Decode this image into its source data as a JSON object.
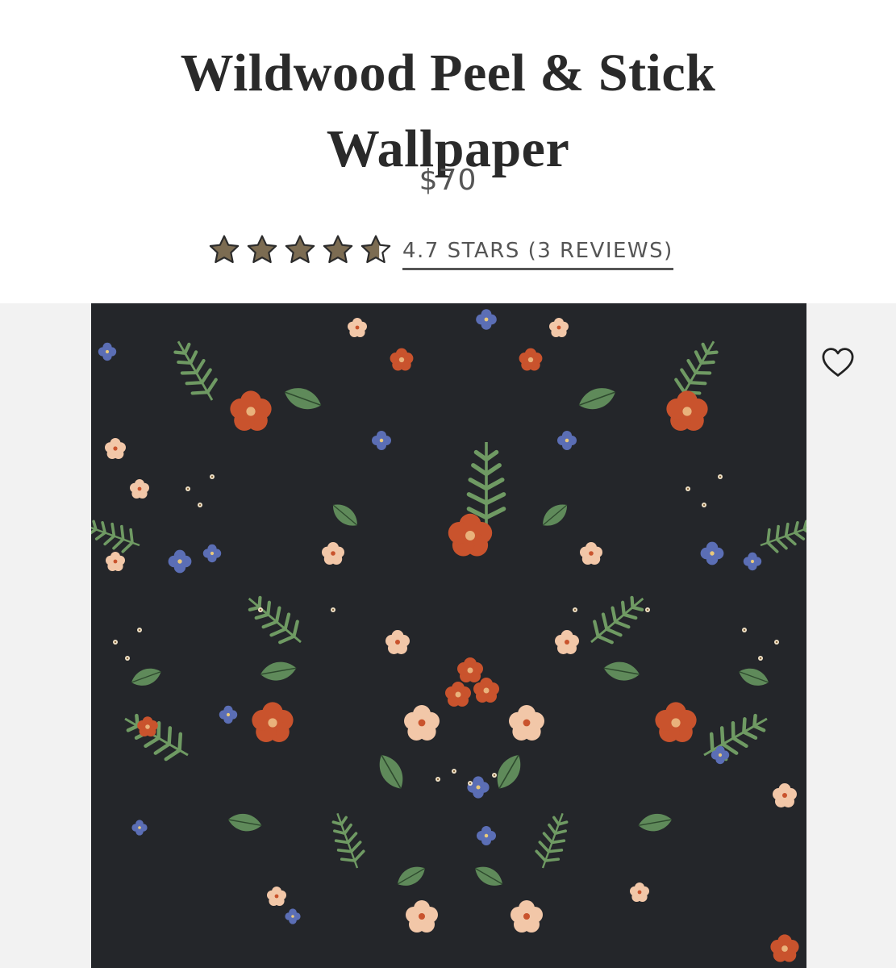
{
  "product": {
    "title_line1": "Wildwood Peel & Stick",
    "title_line2": "Wallpaper",
    "price": "$70",
    "rating_value": 4.7,
    "rating_max": 5,
    "rating_link": "4.7 STARS (3 REVIEWS)"
  },
  "icons": {
    "star": "star-icon",
    "wishlist": "heart-outline-icon"
  },
  "colors": {
    "star_fill": "#7c6c52",
    "star_stroke": "#2b2b2b",
    "wallpaper_bg": "#24262a"
  }
}
